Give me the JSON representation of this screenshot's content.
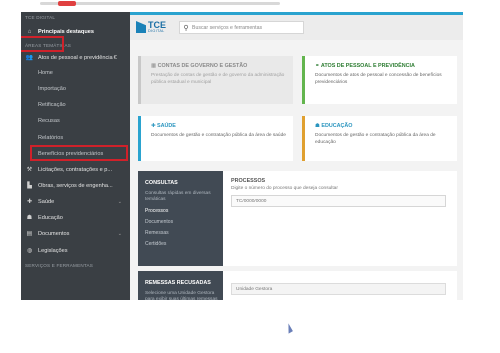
{
  "sidebar": {
    "top_label": "TCE DIGITAL",
    "items": [
      {
        "icon": "home-icon",
        "label": "Principais destaques",
        "kind": "bold"
      },
      {
        "label": "ÁREAS TEMÁTICAS",
        "kind": "section"
      },
      {
        "icon": "users-icon",
        "label": "Atos de pessoal e previdência",
        "kind": "item",
        "caret": "€"
      },
      {
        "label": "Home",
        "kind": "sub"
      },
      {
        "label": "Importação",
        "kind": "sub"
      },
      {
        "label": "Retificação",
        "kind": "sub"
      },
      {
        "label": "Recusas",
        "kind": "sub"
      },
      {
        "label": "Relatórios",
        "kind": "sub"
      },
      {
        "label": "Benefícios previdenciários",
        "kind": "sub"
      },
      {
        "icon": "gavel-icon",
        "label": "Licitações, contratações e p...",
        "kind": "item"
      },
      {
        "icon": "building-icon",
        "label": "Obras, serviços de engenha...",
        "kind": "item"
      },
      {
        "icon": "plus-icon",
        "label": "Saúde",
        "kind": "item",
        "caret": "⌄"
      },
      {
        "icon": "education-icon",
        "label": "Educação",
        "kind": "item"
      },
      {
        "icon": "document-icon",
        "label": "Documentos",
        "kind": "item",
        "caret": "⌄"
      },
      {
        "icon": "globe-icon",
        "label": "Legislações",
        "kind": "item"
      },
      {
        "label": "SERVIÇOS E FERRAMENTAS",
        "kind": "section"
      }
    ]
  },
  "header": {
    "logo_text": "TCE",
    "logo_sub": "DIGITAL",
    "search_placeholder": "Buscar serviços e ferramentas",
    "accent": "#2aa3cf"
  },
  "cards": {
    "governo": {
      "title": "CONTAS DE GOVERNO E GESTÃO",
      "desc": "Prestação de contas de gestão e de governo da administração pública estadual e municipal"
    },
    "atos": {
      "title": "ATOS DE PESSOAL E PREVIDÊNCIA",
      "desc": "Documentos de atos de pessoal e concessão de benefícios previdenciários"
    },
    "saude": {
      "title": "SAÚDE",
      "desc": "Documentos de gestão e contratação pública da área de saúde"
    },
    "educacao": {
      "title": "EDUCAÇÃO",
      "desc": "Documentos de gestão e contratação pública da área de educação"
    }
  },
  "consultas": {
    "title": "CONSULTAS",
    "desc": "Consultas rápidas em diversas temáticas",
    "links": [
      "Processos",
      "Documentos",
      "Remessas",
      "Certidões"
    ],
    "processos_title": "PROCESSOS",
    "processos_desc": "Digite o número do processo que deseja consultar",
    "processos_placeholder": "TC/0000/0000"
  },
  "recusadas": {
    "title": "REMESSAS RECUSADAS",
    "desc": "Selecione uma Unidade Gestora para exibir suas últimas remessas recusadas",
    "field": "Unidade Gestora"
  }
}
